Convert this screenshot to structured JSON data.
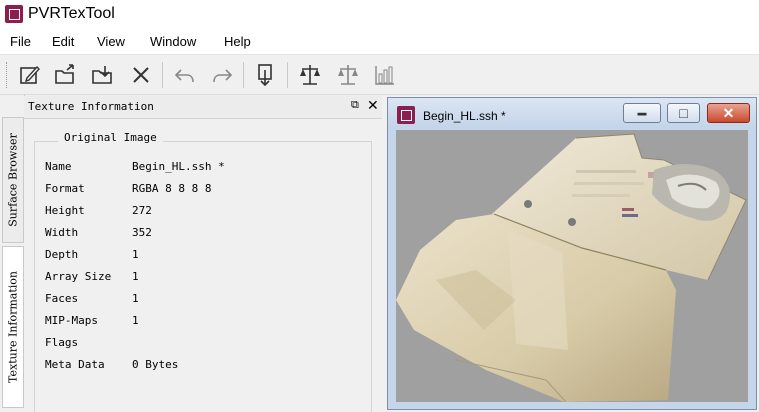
{
  "app": {
    "title": "PVRTexTool"
  },
  "menu": [
    "File",
    "Edit",
    "View",
    "Window",
    "Help"
  ],
  "toolbar": {
    "buttons": [
      "edit-icon",
      "open-icon",
      "save-icon",
      "close-icon",
      "undo-icon",
      "redo-icon",
      "encode-icon",
      "compare-icon",
      "diff-icon",
      "histogram-icon"
    ]
  },
  "sidetabs": [
    {
      "label": "Surface Browser",
      "active": false
    },
    {
      "label": "Texture Information",
      "active": true
    }
  ],
  "panel": {
    "title": "Texture Information",
    "float_glyph": "⧉",
    "close_glyph": "✕",
    "group_title": "Original Image",
    "rows": [
      {
        "key": "Name",
        "value": "Begin_HL.ssh *"
      },
      {
        "key": "Format",
        "value": "RGBA 8 8 8 8"
      },
      {
        "key": "Height",
        "value": "272"
      },
      {
        "key": "Width",
        "value": "352"
      },
      {
        "key": "Depth",
        "value": "1"
      },
      {
        "key": "Array Size",
        "value": "1"
      },
      {
        "key": "Faces",
        "value": "1"
      },
      {
        "key": "MIP-Maps",
        "value": "1"
      },
      {
        "key": "Flags",
        "value": ""
      },
      {
        "key": "Meta Data",
        "value": "0 Bytes"
      }
    ]
  },
  "subwindow": {
    "title": "Begin_HL.ssh *",
    "min_glyph": "▬",
    "max_glyph": "□",
    "close_glyph": "✕"
  },
  "colors": {
    "viewport_bg": "#a0a0a0",
    "close_button": "#c9492e",
    "app_icon": "#8b1d4f"
  }
}
